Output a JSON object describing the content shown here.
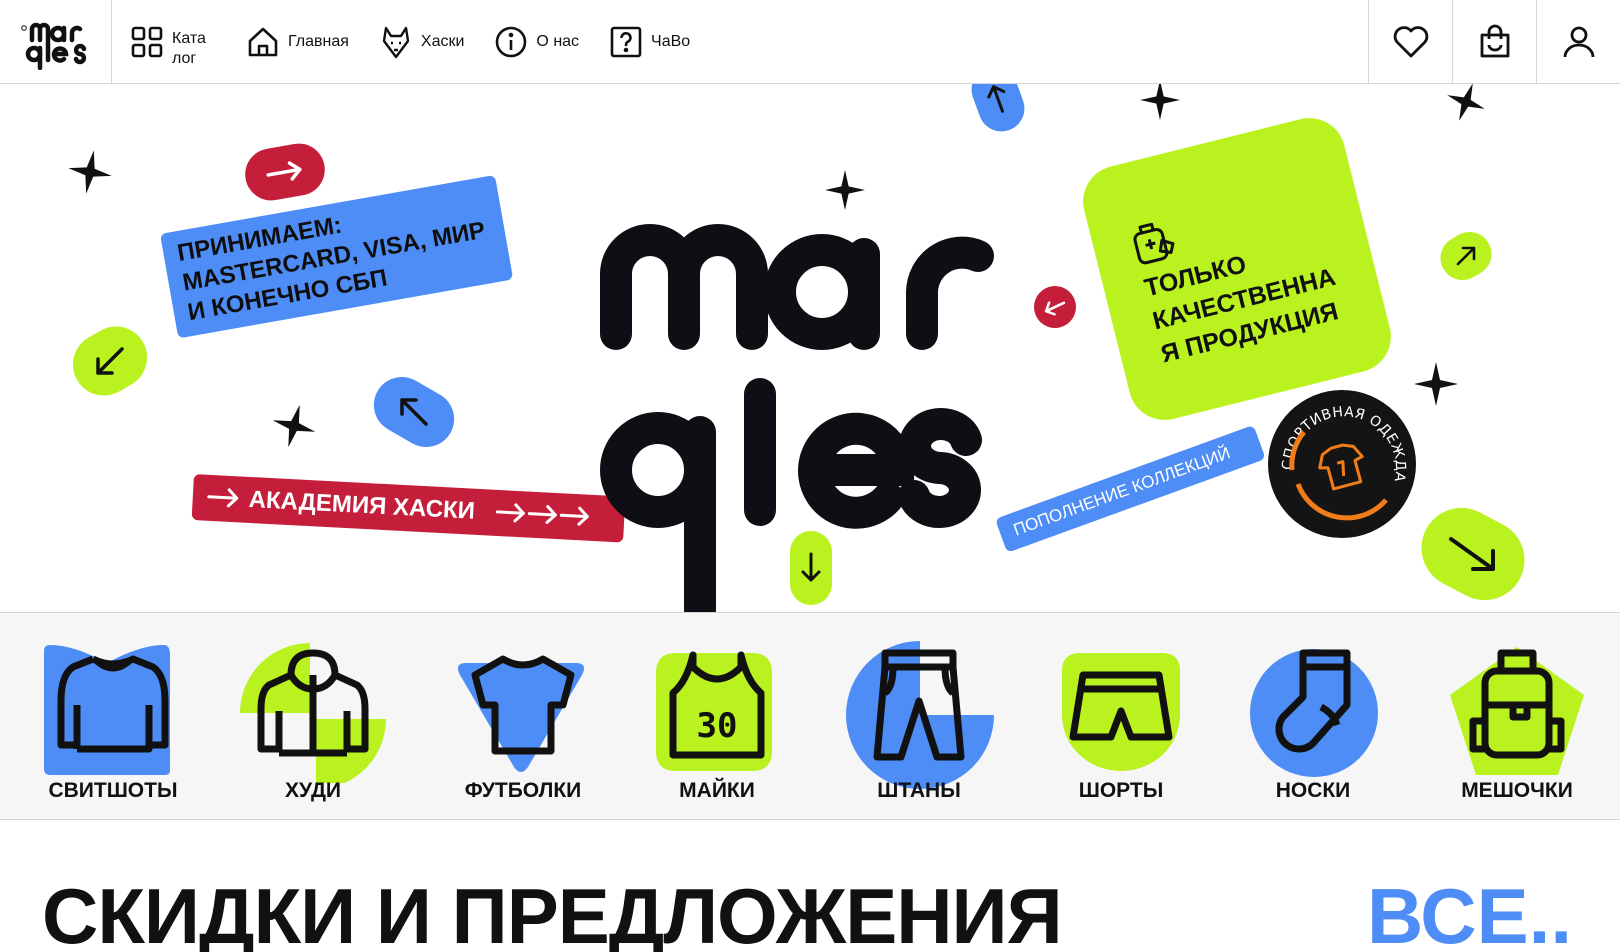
{
  "header": {
    "logo": "marqles",
    "nav": [
      {
        "label": "Ката лог",
        "icon": "catalog-grid-icon"
      },
      {
        "label": "Главная",
        "icon": "home-icon"
      },
      {
        "label": "Хаски",
        "icon": "husky-icon"
      },
      {
        "label": "О нас",
        "icon": "info-icon"
      },
      {
        "label": "ЧаВо",
        "icon": "faq-icon"
      }
    ],
    "actions": [
      "heart-icon",
      "bag-icon",
      "user-icon"
    ]
  },
  "hero": {
    "brand": "marqles",
    "payment_tag": "ПРИНИМАЕМ: MASTERCARD, VISA, МИР И КОНЕЧНО СБП",
    "academy_tag": "АКАДЕМИЯ ХАСКИ",
    "quality_card": "ТОЛЬКО КАЧЕСТВЕННА Я ПРОДУКЦИЯ",
    "collection_tag": "ПОПОЛНЕНИЕ КОЛЛЕКЦИЙ",
    "round_badge": "СПОРТИВНАЯ ОДЕЖДА",
    "colors": {
      "blue": "#4e8df5",
      "green": "#b9f21f",
      "red": "#c41e3a",
      "dark": "#141414"
    }
  },
  "categories": [
    {
      "label": "СВИТШОТЫ",
      "icon": "sweatshirt-icon"
    },
    {
      "label": "ХУДИ",
      "icon": "hoodie-icon"
    },
    {
      "label": "ФУТБОЛКИ",
      "icon": "tshirt-icon"
    },
    {
      "label": "МАЙКИ",
      "icon": "tank-top-icon",
      "number": "30"
    },
    {
      "label": "ШТАНЫ",
      "icon": "pants-icon"
    },
    {
      "label": "ШОРТЫ",
      "icon": "shorts-icon"
    },
    {
      "label": "НОСКИ",
      "icon": "sock-icon"
    },
    {
      "label": "МЕШОЧКИ",
      "icon": "backpack-icon"
    }
  ],
  "offers": {
    "title": "СКИДКИ И ПРЕДЛОЖЕНИЯ",
    "all_link": "ВСЕ.."
  }
}
